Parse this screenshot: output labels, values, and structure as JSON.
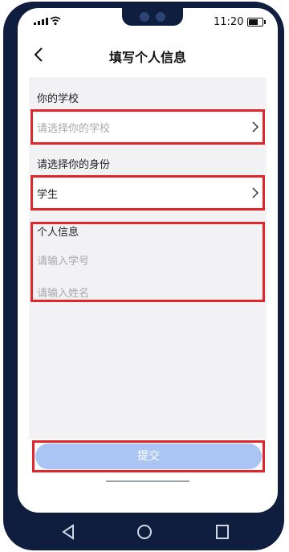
{
  "status_bar": {
    "time": "11:20",
    "battery_level": 0.8
  },
  "header": {
    "title": "填写个人信息",
    "back_icon": "chevron-left-icon"
  },
  "school": {
    "label": "你的学校",
    "placeholder": "请选择你的学校",
    "chevron_icon": "chevron-right-icon"
  },
  "identity": {
    "label": "请选择你的身份",
    "value": "学生",
    "chevron_icon": "chevron-right-icon"
  },
  "personal_info": {
    "label": "个人信息",
    "student_id_placeholder": "请输入学号",
    "name_placeholder": "请输入姓名"
  },
  "submit": {
    "label": "提交"
  },
  "colors": {
    "highlight": "#e0262a",
    "submit_bg": "#aac4f4",
    "frame": "#0f1d3f"
  },
  "system_nav": {
    "back_icon": "triangle-back-icon",
    "home_icon": "circle-home-icon",
    "recent_icon": "square-recent-icon"
  }
}
